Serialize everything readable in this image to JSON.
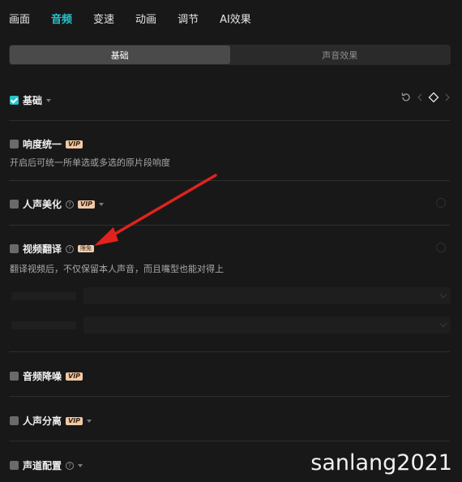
{
  "tabs": [
    {
      "label": "画面",
      "active": false
    },
    {
      "label": "音频",
      "active": true
    },
    {
      "label": "变速",
      "active": false
    },
    {
      "label": "动画",
      "active": false
    },
    {
      "label": "调节",
      "active": false
    },
    {
      "label": "AI效果",
      "active": false
    }
  ],
  "segments": [
    {
      "label": "基础",
      "active": true
    },
    {
      "label": "声音效果",
      "active": false
    }
  ],
  "sections": {
    "basic": {
      "label": "基础",
      "checked": true
    },
    "loudness": {
      "label": "响度统一",
      "badge": "VIP",
      "checked": false,
      "desc": "开启后可统一所单选或多选的原片段响度"
    },
    "voice_beautify": {
      "label": "人声美化",
      "badge": "VIP",
      "checked": false
    },
    "video_translate": {
      "label": "视频翻译",
      "badge": "限免",
      "checked": false,
      "desc": "翻译视频后，不仅保留本人声音，而且嘴型也能对得上"
    },
    "denoise": {
      "label": "音频降噪",
      "badge": "VIP",
      "checked": false
    },
    "voice_separate": {
      "label": "人声分离",
      "badge": "VIP",
      "checked": false
    },
    "channel": {
      "label": "声道配置",
      "checked": false
    }
  },
  "icons": {
    "reset": "reset-icon",
    "keyframe": "keyframe-diamond-icon",
    "help": "question-icon",
    "dropdown": "chevron-down-icon"
  },
  "colors": {
    "accent": "#27c4cc",
    "vip_bg": "#f0c9a6",
    "annotation_arrow": "#e0231f"
  },
  "watermark": "sanlang2021"
}
